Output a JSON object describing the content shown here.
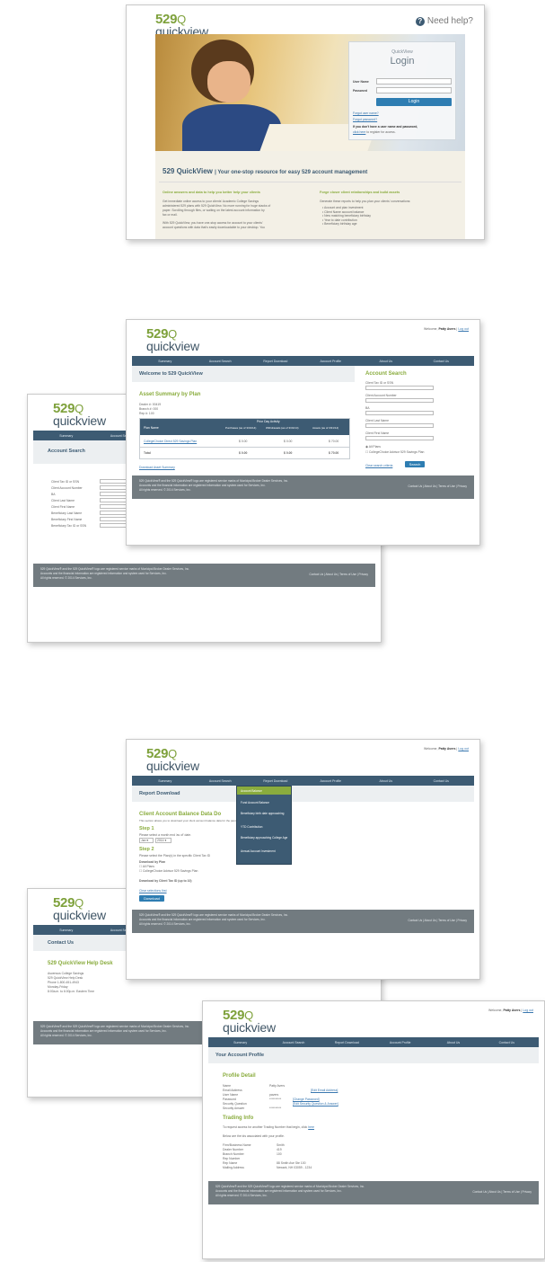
{
  "brand": {
    "num": "529",
    "q": "Q",
    "word": "quickview"
  },
  "login_page": {
    "help_label": "Need help?",
    "panel_small": "QuickView",
    "panel_title": "Login",
    "username_label": "User Name",
    "password_label": "Password",
    "login_button": "Login",
    "forgot_user": "Forgot user name?",
    "forgot_pass": "Forgot password?",
    "register_prompt": "If you don't have a user name and password,",
    "register_link": "click here",
    "register_tail": "to register for access.",
    "headline_main": "529 QuickView",
    "headline_tail": "| Your one-stop resource for easy 529 account management",
    "col1_heading": "Online answers and data to help you better help your clients",
    "col1_text_1": "Get immediate online access to your clients' Academic College Savings",
    "col1_text_2": "administered 529 plans with 529 QuickView. No more running for huge stacks of",
    "col1_text_3": "paper. Scrolling through files, or waiting on the latest account information by",
    "col1_text_4": "fax or mail.",
    "col1_text_5": "With 529 QuickView, you have one-stop access for account to your clients'",
    "col1_text_6": "account questions with data that's easily downloadable to your desktop. You",
    "col2_heading": "Forge closer client relationships and build assets",
    "col2_text": "Generate these reports to help you plan your clients' conversations:",
    "bullets": [
      "Account and plan investment",
      "Client Name account balance",
      "New matching beneficiary birthday",
      "Year to date contribution",
      "Beneficiary birthday age"
    ]
  },
  "common": {
    "welcome_prefix": "Welcome,",
    "welcome_user": "Patty Avers",
    "logout": "Log out",
    "footer_line1": "529 QuickView® and the 529 QuickView® logo are registered service marks of Municipal Broker Dealer Services, Inc.",
    "footer_line2": "Accounts and the financial information are registered information and system used for Services, Inc.",
    "footer_line3": "All rights reserved. © 2014 Services, Inc.",
    "footer_right": "Contact Us | About Us | Terms of Use | Privacy",
    "nav": [
      "Summary",
      "Account Search",
      "Report Download",
      "Account Profile",
      "About Us",
      "Contact Us"
    ]
  },
  "account_search": {
    "title": "Account Search",
    "labels": [
      "Client Tax ID or SSN",
      "Client Account Number",
      "BA",
      "Client Last Name",
      "Client First Name",
      "Beneficiary Last Name",
      "Beneficiary First Name",
      "Beneficiary Tax ID or SSN"
    ],
    "search_button": "Search"
  },
  "welcome_page": {
    "title": "Welcome to 529 QuickView",
    "summary_heading": "Asset Summary by Plan",
    "meta_1": "Dealer #: 00419",
    "meta_2": "Branch #: 000",
    "meta_3": "Rep #: 100",
    "table_group": "Prior Day Activity",
    "col_plan": "Plan Name",
    "col_purchases": "Purchases (as of 3/31/14)",
    "col_withdrawals": "Withdrawals (as of 3/31/14)",
    "col_assets": "Assets (as of 3/31/14)",
    "row_plan": "CollegeChoice Direct 529 Savings Plan",
    "row_v1": "$ 0.00",
    "row_v2": "$ 0.00",
    "row_v3": "$ 70.00",
    "total_label": "Total",
    "total_v1": "$ 0.00",
    "total_v2": "$ 0.00",
    "total_v3": "$ 70.00",
    "download_link": "Download Asset Summary",
    "side_title": "Account Search",
    "side_fields": [
      "Client Tax ID or SSN",
      "Client Account Number",
      "BA",
      "Client Last Name",
      "Client First Name"
    ],
    "opt_all": "All Plans",
    "opt_cc": "CollegeChoice Advisor 529 Savings Plan",
    "clear_link": "Clear search criteria",
    "side_button": "Search"
  },
  "contact_page": {
    "title": "Contact Us",
    "heading": "529 QuickView Help Desk",
    "lines": [
      "Ascensus College Savings",
      "529 QuickView Help Desk",
      "Phone 1-800-451-4943",
      "Monday-Friday",
      "8:00a.m. to 6:00p.m. Eastern Time"
    ]
  },
  "report_page": {
    "title": "Report Download",
    "heading": "Client Account Balance Data Do",
    "intro": "This section allows you to download your client account balance data for the past 13 months.",
    "step1": "Step 1",
    "step1_text": "Please select a month end 'as of' date.",
    "month": "Jan",
    "year": "2014",
    "step2": "Step 2",
    "step2_text": "Please select the Plan(s) in the specific Client Tax ID",
    "download_by_plan": "Download by Plan",
    "opt_all": "All Plans",
    "opt_cc": "CollegeChoice Advisor 529 Savings Plan",
    "download_by_client": "Download by Client Tax ID (up to 10)",
    "clear_link": "Clear selections first",
    "download_button": "Download",
    "menu": [
      "Account Balance",
      "Fund Account Balance",
      "Beneficiary birth date approaching",
      "YTD Contribution",
      "Beneficiary approaching College Age",
      "Annual Account Investment"
    ]
  },
  "profile_page": {
    "title": "Your Account Profile",
    "profile_heading": "Profile Detail",
    "labels": [
      "Name",
      "Email Address",
      "User Name",
      "Password",
      "Security Question",
      "Security Answer"
    ],
    "values": [
      "Patty Avers",
      "",
      "pavers",
      "**********",
      "",
      "**********"
    ],
    "edit_email": "[Edit Email Address]",
    "change_password": "[Change Password]",
    "edit_security": "[Edit Security Question & Answer]",
    "trading_heading": "Trading Info",
    "trading_text_1": "To request access for another Trading Number that begin, click",
    "trading_link": "here",
    "trading_text_2": "Below are the ids associated with your profile.",
    "trade_labels": [
      "Firm/Business Name",
      "Dealer Number",
      "Branch Number",
      "Rep Number",
      "Rep Name",
      "Mailing Address"
    ],
    "trade_values": [
      "Smith",
      "419",
      "100",
      "",
      "88 Smith Ave Ste 100",
      "Newark, NH 03059 - 1234"
    ]
  }
}
